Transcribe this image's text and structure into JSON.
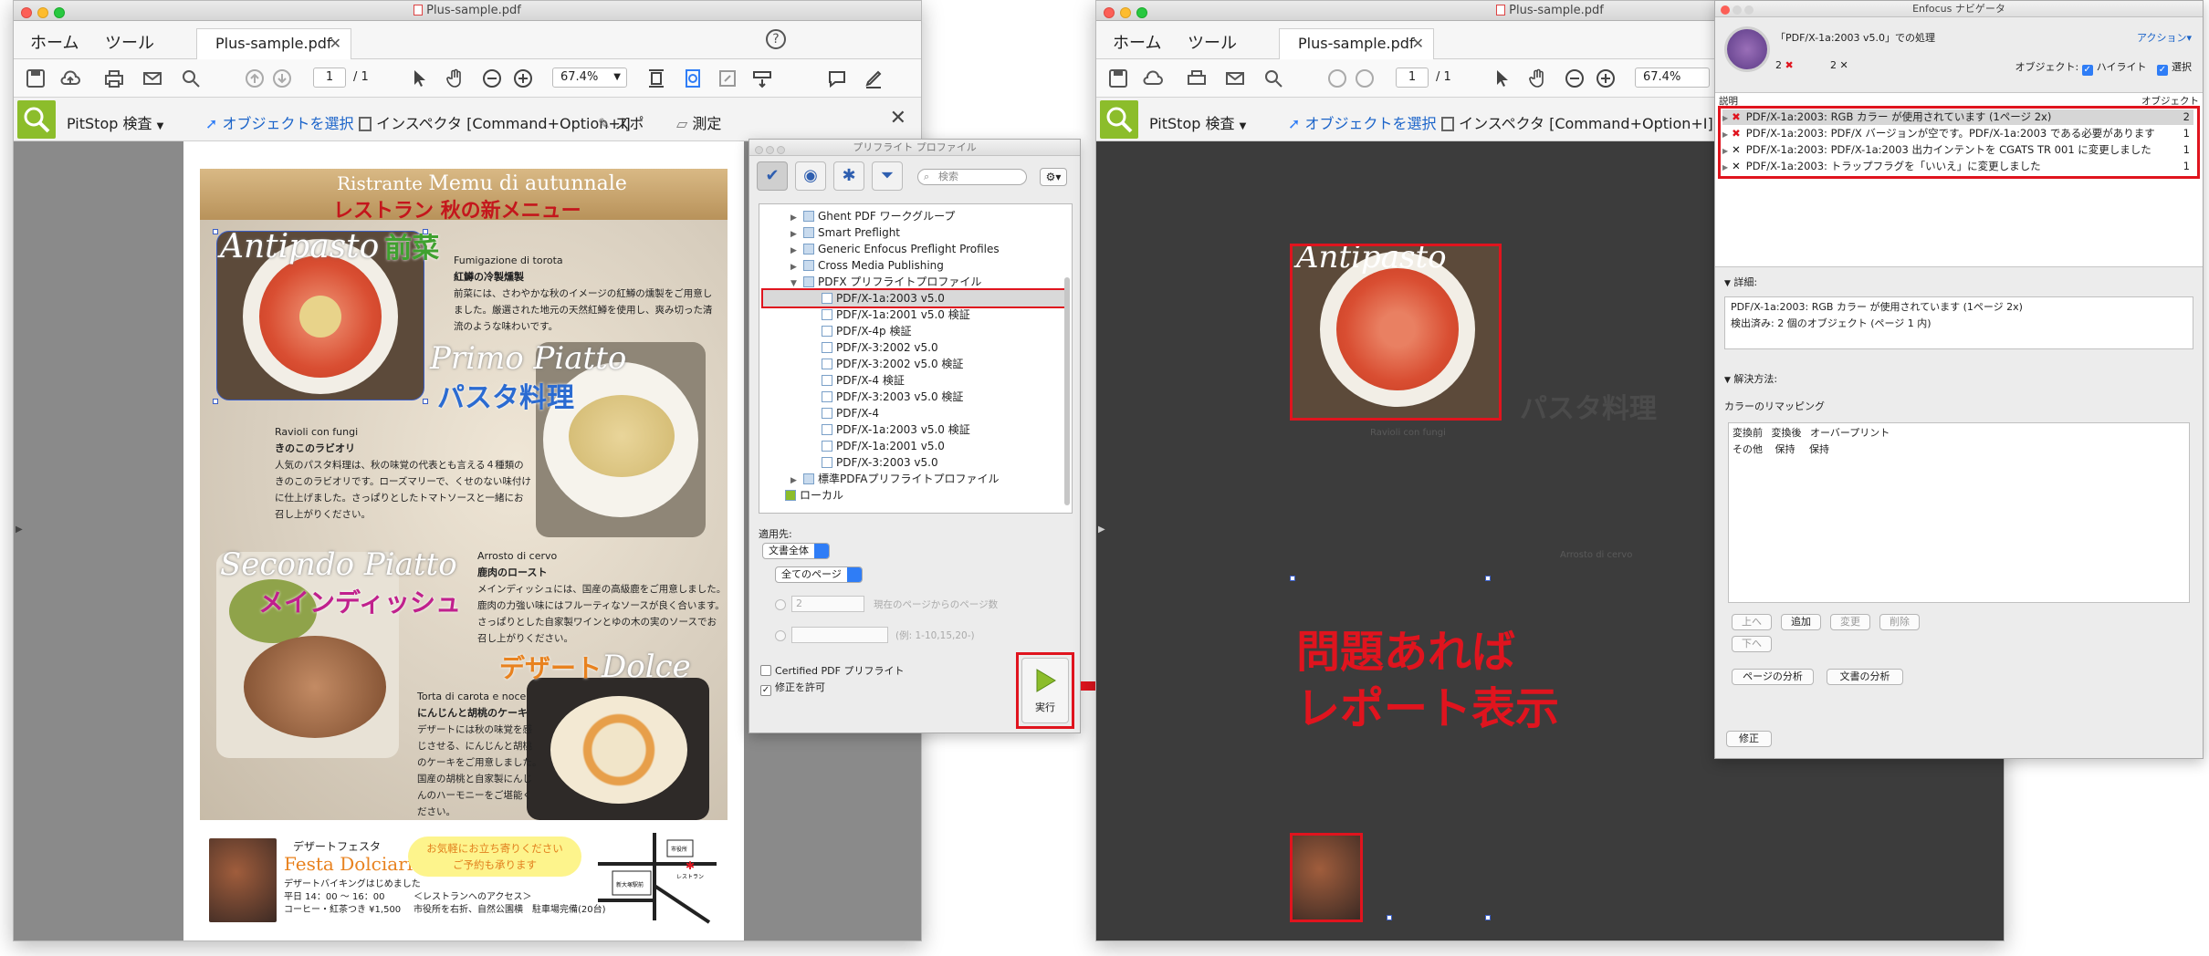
{
  "left_window": {
    "title": "Plus-sample.pdf",
    "menu": [
      "ホーム",
      "ツール"
    ],
    "tab_label": "Plus-sample.pdf",
    "page_current": "1",
    "page_total": "/ 1",
    "zoom": "67.4%",
    "pitstop": {
      "label": "PitStop 検査",
      "select_object": "オブジェクトを選択",
      "inspector": "インスペクタ [Command+Option+I]",
      "spot": "スポ",
      "measure": "測定"
    }
  },
  "menu_page": {
    "header_it": "Ristrante",
    "header_it2": "Memu di autunnale",
    "header_jp": "レストラン 秋の新メニュー",
    "antipasto": "Antipasto",
    "antipasto_jp": "前菜",
    "antipasto_item_it": "Fumigazione di torota",
    "antipasto_item_jp": "紅鱒の冷製燻製",
    "antipasto_desc": [
      "前菜には、さわやかな秋のイメージの紅鱒の燻製をご用意し",
      "ました。厳選された地元の天然紅鱒を使用し、爽み切った清",
      "流のような味わいです。"
    ],
    "primo": "Primo Piatto",
    "primo_jp": "パスタ料理",
    "primo_item_it": "Ravioli con fungi",
    "primo_item_jp": "きのこのラビオリ",
    "primo_desc": [
      "人気のパスタ料理は、秋の味覚の代表とも言える４種類の",
      "きのこのラビオリです。ローズマリーで、くせのない味付け",
      "に仕上げました。さっぱりとしたトマトソースと一緒にお",
      "召し上がりください。"
    ],
    "secondo": "Secondo Piatto",
    "secondo_jp": "メインディッシュ",
    "secondo_item_it": "Arrosto di cervo",
    "secondo_item_jp": "鹿肉のロースト",
    "secondo_desc": [
      "メインディッシュには、国産の高級鹿をご用意しました。",
      "鹿肉の力強い味にはフルーティなソースが良く合います。",
      "さっぱりとした自家製ワインとゆの木の実のソースでお",
      "召し上がりください。"
    ],
    "dolce": "Dolce",
    "dolce_jp": "デザート",
    "dolce_item_it": "Torta di carota e noce",
    "dolce_item_jp": "にんじんと胡桃のケーキ",
    "dolce_desc": [
      "デザートには秋の味覚を感",
      "じさせる、にんじんと胡桃",
      "のケーキをご用意しました。",
      "国産の胡桃と自家製にんじ",
      "んのハーモニーをご堪能く",
      "ださい。"
    ],
    "festa_title": "デザートフェスタ",
    "festa_it": "Festa Dolciario",
    "festa_l1": "デザートバイキングはじめました",
    "festa_l2": "平日 14：00 〜 16：00",
    "festa_l3": "コーヒー・紅茶つき ¥1,500",
    "bubble_l1": "お気軽にお立ち寄りください",
    "bubble_l2": "ご予約も承ります",
    "access_l1": "＜レストランへのアクセス＞",
    "access_l2": "市役所を右折、自然公園横　駐車場完備(20台)",
    "map_station": "新大塚駅前",
    "map_hall": "市役所",
    "map_rest": "レストラン"
  },
  "preflight_panel": {
    "title": "プリフライト プロファイル",
    "search_placeholder": "検索",
    "tree": [
      {
        "label": "Ghent PDF ワークグループ",
        "indent": 1
      },
      {
        "label": "Smart Preflight",
        "indent": 1
      },
      {
        "label": "Generic Enfocus Preflight Profiles",
        "indent": 1
      },
      {
        "label": "Cross Media Publishing",
        "indent": 1
      },
      {
        "label": "PDFX プリフライトプロファイル",
        "indent": 1
      },
      {
        "label": "PDF/X-1a:2003 v5.0",
        "indent": 2
      },
      {
        "label": "PDF/X-1a:2001 v5.0 検証",
        "indent": 2
      },
      {
        "label": "PDF/X-4p 検証",
        "indent": 2
      },
      {
        "label": "PDF/X-3:2002 v5.0",
        "indent": 2
      },
      {
        "label": "PDF/X-3:2002 v5.0 検証",
        "indent": 2
      },
      {
        "label": "PDF/X-4 検証",
        "indent": 2
      },
      {
        "label": "PDF/X-3:2003 v5.0 検証",
        "indent": 2
      },
      {
        "label": "PDF/X-4",
        "indent": 2
      },
      {
        "label": "PDF/X-1a:2003 v5.0 検証",
        "indent": 2
      },
      {
        "label": "PDF/X-1a:2001 v5.0",
        "indent": 2
      },
      {
        "label": "PDF/X-3:2003 v5.0",
        "indent": 2
      },
      {
        "label": "標準PDFAプリフライトプロファイル",
        "indent": 1
      },
      {
        "label": "ローカル",
        "indent": 0
      }
    ],
    "apply_label": "適用先:",
    "apply_doc": "文書全体",
    "apply_pages": "全てのページ",
    "page_count": "2",
    "page_count_label": "現在のページからのページ数",
    "page_example": "(例: 1-10,15,20-)",
    "certified": "Certified PDF プリフライト",
    "allow_fix": "修正を許可",
    "run": "実行"
  },
  "annotation": {
    "line1": "問題あれば",
    "line2": "レポート表示"
  },
  "navigator": {
    "title": "Enfocus ナビゲータ",
    "header": "「PDF/X-1a:2003 v5.0」での処理",
    "action": "アクション",
    "errors": "2",
    "fixes": "2",
    "object_label": "オブジェクト:",
    "highlight": "ハイライト",
    "select": "選択",
    "col_desc": "説明",
    "col_obj": "オブジェクト",
    "rows": [
      {
        "text": "PDF/X-1a:2003: RGB カラー が使用されています (1ページ 2x)",
        "count": "2",
        "kind": "error"
      },
      {
        "text": "PDF/X-1a:2003: PDF/X バージョンが空です。PDF/X-1a:2003 である必要があります",
        "count": "1",
        "kind": "error"
      },
      {
        "text": "PDF/X-1a:2003: PDF/X-1a:2003 出力インテントを CGATS TR 001 に変更しました",
        "count": "1",
        "kind": "fix"
      },
      {
        "text": "PDF/X-1a:2003: トラップフラグを「いいえ」に変更しました",
        "count": "1",
        "kind": "fix"
      }
    ],
    "details_label": "詳細:",
    "details_l1": "PDF/X-1a:2003: RGB カラー が使用されています (1ページ 2x)",
    "details_l2": "検出済み: 2 個のオブジェクト (ページ 1 内)",
    "solution_label": "解決方法:",
    "remap_label": "カラーのリマッピング",
    "remap_header": [
      "変換前",
      "変換後",
      "オーバープリント"
    ],
    "remap_row": [
      "その他",
      "保持",
      "保持"
    ],
    "btn_up": "上へ",
    "btn_add": "追加",
    "btn_change": "変更",
    "btn_delete": "削除",
    "btn_down": "下へ",
    "btn_page_analysis": "ページの分析",
    "btn_doc_analysis": "文書の分析",
    "btn_fix": "修正"
  },
  "colors": {
    "accent_red": "#e0141e",
    "pitstop_green": "#8cbd2b",
    "selection_blue": "#2f7df6"
  }
}
